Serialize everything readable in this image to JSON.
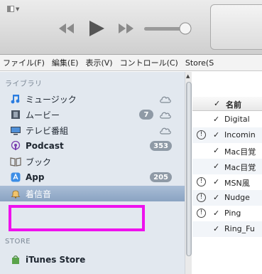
{
  "toolbar": {
    "icons": [
      "window-menu-icon",
      "previous-icon",
      "play-icon",
      "next-icon",
      "volume-slider"
    ]
  },
  "menubar": {
    "items": [
      "ファイル(F)",
      "編集(E)",
      "表示(V)",
      "コントロール(C)",
      "Store(S"
    ]
  },
  "sidebar": {
    "library_header": "ライブラリ",
    "store_header": "STORE",
    "items": [
      {
        "label": "ミュージック",
        "icon": "music-note-icon",
        "bold": false,
        "badge": "",
        "cloud": true
      },
      {
        "label": "ムービー",
        "icon": "film-icon",
        "bold": false,
        "badge": "7",
        "cloud": true
      },
      {
        "label": "テレビ番組",
        "icon": "tv-icon",
        "bold": false,
        "badge": "",
        "cloud": true
      },
      {
        "label": "Podcast",
        "icon": "podcast-icon",
        "bold": true,
        "badge": "353",
        "cloud": false
      },
      {
        "label": "ブック",
        "icon": "book-icon",
        "bold": false,
        "badge": "",
        "cloud": false
      },
      {
        "label": "App",
        "icon": "app-store-icon",
        "bold": true,
        "badge": "205",
        "cloud": false
      },
      {
        "label": "着信音",
        "icon": "bell-icon",
        "bold": false,
        "badge": "",
        "cloud": false,
        "selected": true
      }
    ],
    "store_items": [
      {
        "label": "iTunes Store",
        "icon": "shopping-bag-icon",
        "bold": true
      }
    ]
  },
  "list": {
    "check_header": "✓",
    "name_header": "名前",
    "rows": [
      {
        "warn": false,
        "check": "✓",
        "name": "Digital"
      },
      {
        "warn": true,
        "check": "✓",
        "name": "Incomin"
      },
      {
        "warn": false,
        "check": "✓",
        "name": "Mac目覚"
      },
      {
        "warn": false,
        "check": "✓",
        "name": "Mac目覚"
      },
      {
        "warn": true,
        "check": "✓",
        "name": "MSN風"
      },
      {
        "warn": true,
        "check": "✓",
        "name": "Nudge"
      },
      {
        "warn": true,
        "check": "✓",
        "name": "Ping"
      },
      {
        "warn": false,
        "check": "✓",
        "name": "Ring_Fu"
      }
    ]
  },
  "colors": {
    "sidebar_bg": "#e2e8ef",
    "selection": "#8aa3c2",
    "highlight_box": "#ee11ee",
    "badge_bg": "#8f9aa6"
  }
}
